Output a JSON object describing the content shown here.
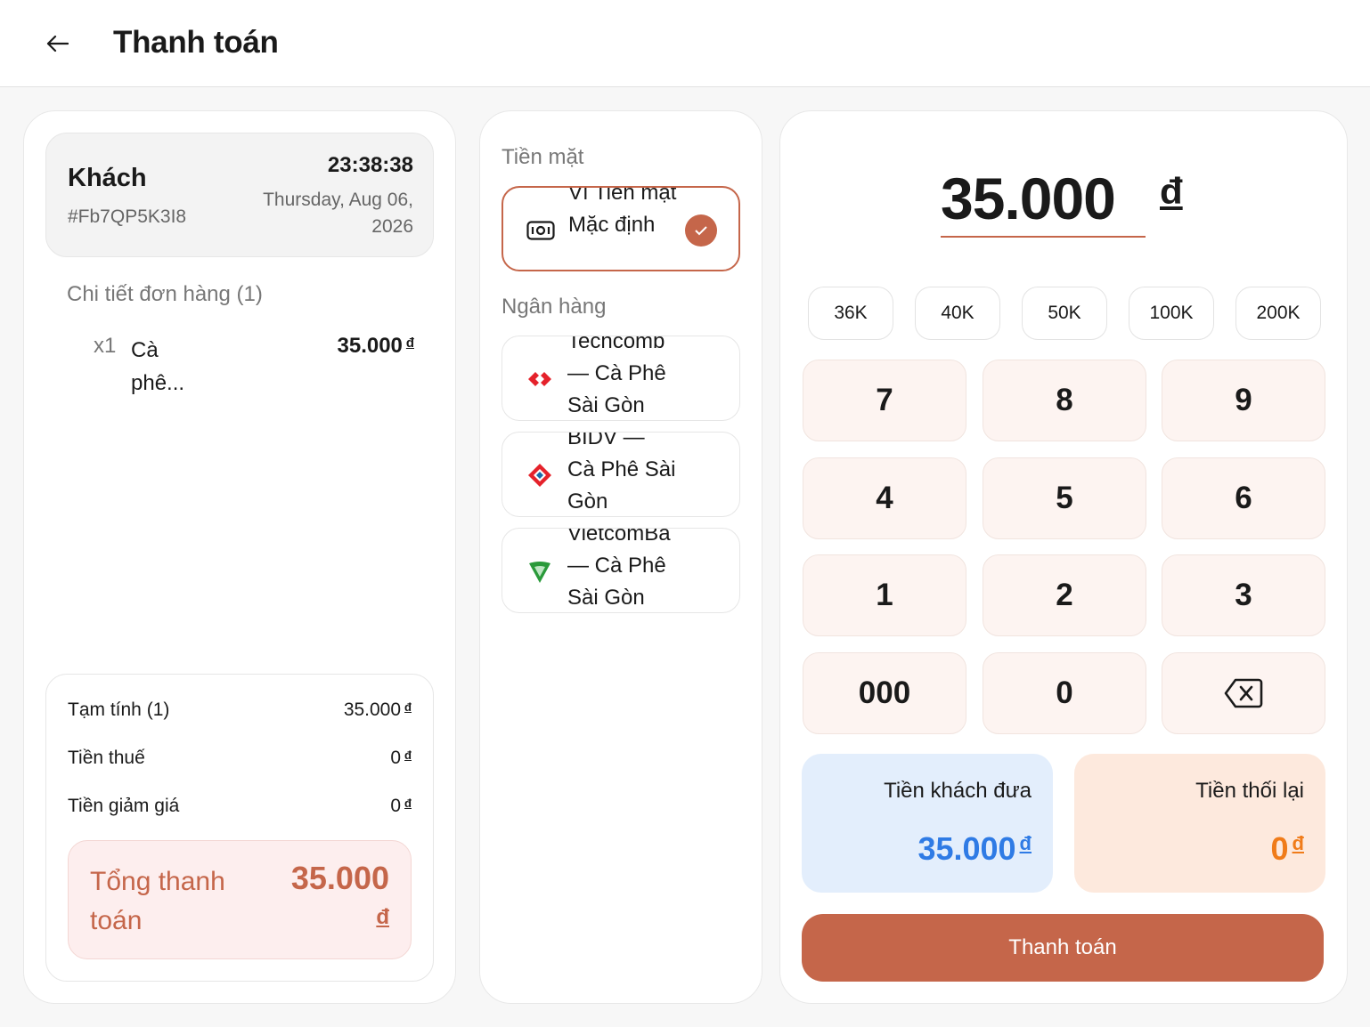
{
  "header": {
    "title": "Thanh toán"
  },
  "customer": {
    "name": "Khách",
    "code": "#Fb7QP5K3I8",
    "time": "23:38:38",
    "date": "Thursday, Aug 06, 2026"
  },
  "order": {
    "section_label": "Chi tiết đơn hàng (1)",
    "items": [
      {
        "qty": "x1",
        "name": "Cà phê...",
        "price": "35.000",
        "currency": "đ"
      }
    ]
  },
  "summary": {
    "subtotal_label": "Tạm tính (1)",
    "subtotal_value": "35.000",
    "tax_label": "Tiền thuế",
    "tax_value": "0",
    "discount_label": "Tiền giảm giá",
    "discount_value": "0",
    "currency": "đ",
    "total_label": "Tổng thanh toán",
    "total_value": "35.000",
    "total_currency": "đ"
  },
  "payment_methods": {
    "cash_label": "Tiền mặt",
    "cash_option": "Ví Tiền mặt Mặc định",
    "bank_label": "Ngân hàng",
    "banks": [
      {
        "label": "Techcomb — Cà Phê Sài Gòn",
        "icon": "techcombank-icon"
      },
      {
        "label": "BIDV — Cà Phê Sài Gòn",
        "icon": "bidv-icon"
      },
      {
        "label": "VietcomBa — Cà Phê Sài Gòn",
        "icon": "vietcombank-icon"
      }
    ]
  },
  "amount": {
    "value": "35.000",
    "currency": "đ"
  },
  "quick_amounts": [
    "36K",
    "40K",
    "50K",
    "100K",
    "200K"
  ],
  "keypad": [
    "7",
    "8",
    "9",
    "4",
    "5",
    "6",
    "1",
    "2",
    "3",
    "000",
    "0"
  ],
  "given": {
    "label": "Tiền khách đưa",
    "value": "35.000",
    "currency": "đ"
  },
  "change": {
    "label": "Tiền thối lại",
    "value": "0",
    "currency": "đ"
  },
  "pay_button": "Thanh toán",
  "colors": {
    "accent": "#c5664a",
    "blue": "#2f7be5",
    "orange": "#f07c1a"
  }
}
